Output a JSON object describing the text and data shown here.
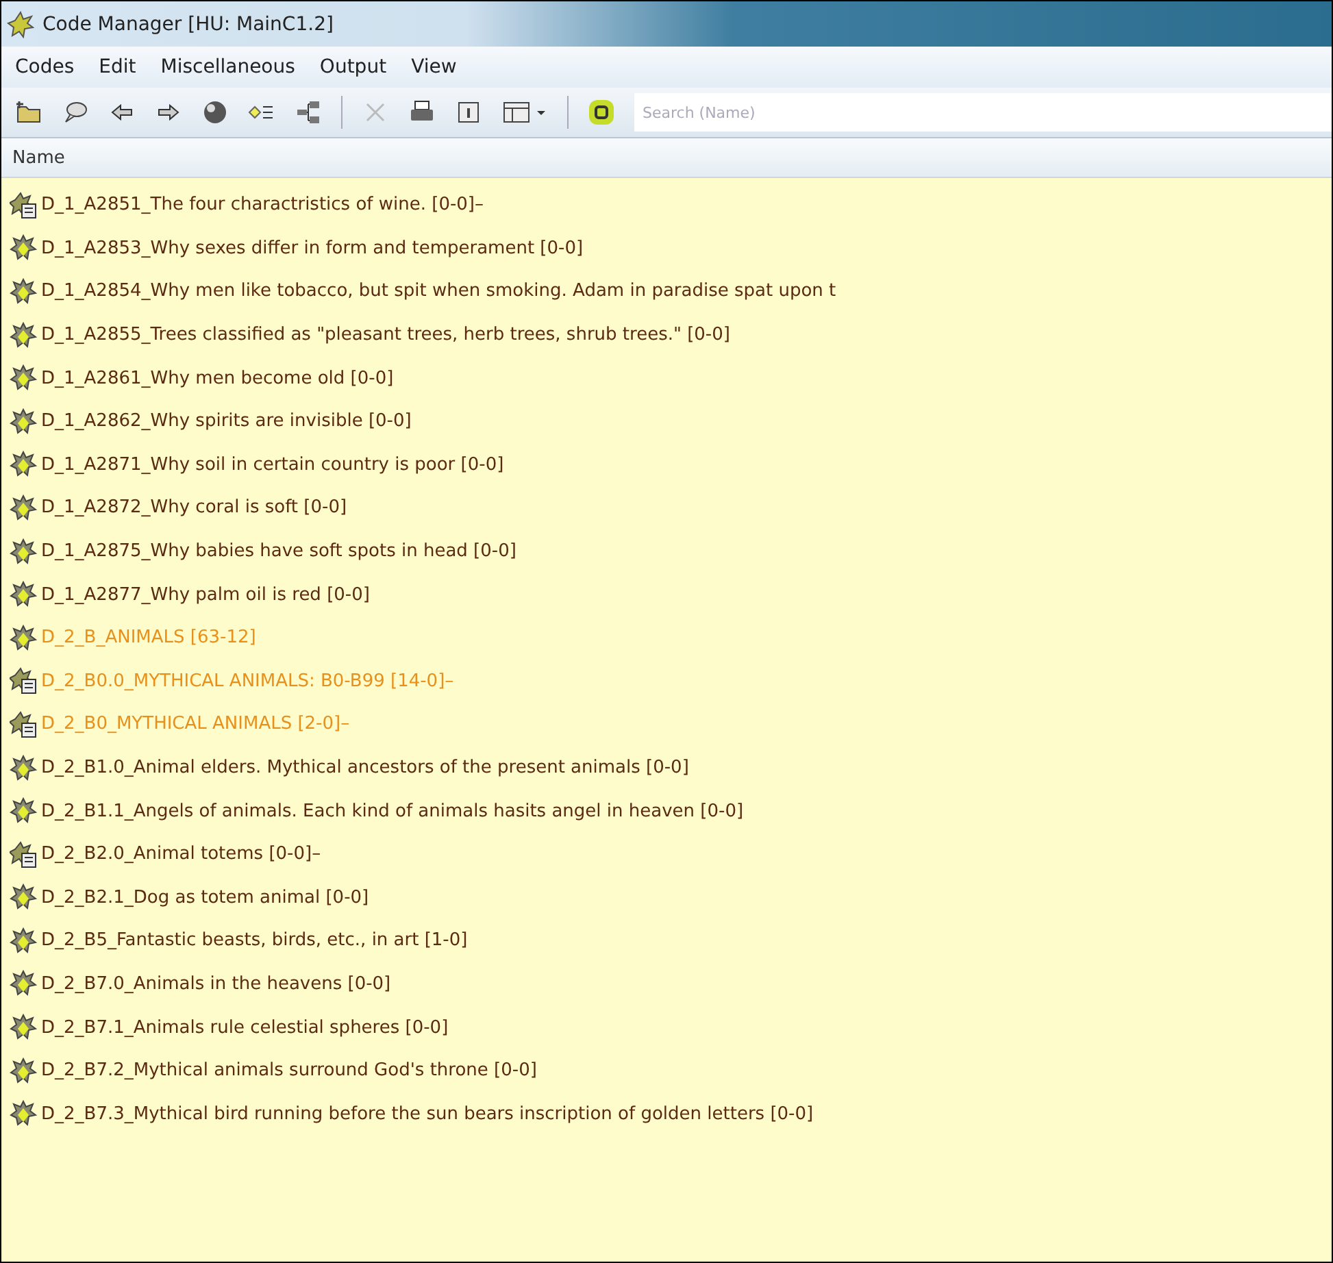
{
  "window": {
    "title": "Code Manager [HU: MainC1.2]"
  },
  "menu": [
    "Codes",
    "Edit",
    "Miscellaneous",
    "Output",
    "View"
  ],
  "search": {
    "placeholder": "Search (Name)"
  },
  "table": {
    "columns": [
      "Name"
    ],
    "rows": [
      {
        "kind": "family",
        "color": "#5a2a12",
        "name": "D_1_A2851_The four charactristics of wine. [0-0]–"
      },
      {
        "kind": "code",
        "color": "#5a2a12",
        "name": "D_1_A2853_Why sexes differ in form and temperament [0-0]"
      },
      {
        "kind": "code",
        "color": "#5a2a12",
        "name": "D_1_A2854_Why men like tobacco, but spit when smoking. Adam in paradise spat upon t"
      },
      {
        "kind": "code",
        "color": "#5a2a12",
        "name": "D_1_A2855_Trees classified as \"pleasant trees, herb trees, shrub trees.\" [0-0]"
      },
      {
        "kind": "code",
        "color": "#5a2a12",
        "name": "D_1_A2861_Why men become old [0-0]"
      },
      {
        "kind": "code",
        "color": "#5a2a12",
        "name": "D_1_A2862_Why spirits are invisible [0-0]"
      },
      {
        "kind": "code",
        "color": "#5a2a12",
        "name": "D_1_A2871_Why soil in certain country is poor [0-0]"
      },
      {
        "kind": "code",
        "color": "#5a2a12",
        "name": "D_1_A2872_Why coral is soft [0-0]"
      },
      {
        "kind": "code",
        "color": "#5a2a12",
        "name": "D_1_A2875_Why babies have soft spots in head [0-0]"
      },
      {
        "kind": "code",
        "color": "#5a2a12",
        "name": "D_1_A2877_Why palm oil is red [0-0]"
      },
      {
        "kind": "code",
        "color": "#e8901c",
        "name": "D_2_B_ANIMALS [63-12]"
      },
      {
        "kind": "family",
        "color": "#e8901c",
        "name": "D_2_B0.0_MYTHICAL ANIMALS: B0-B99 [14-0]–"
      },
      {
        "kind": "family",
        "color": "#e8901c",
        "name": "D_2_B0_MYTHICAL ANIMALS [2-0]–"
      },
      {
        "kind": "code",
        "color": "#5a2a12",
        "name": "D_2_B1.0_Animal elders. Mythical ancestors of the present animals [0-0]"
      },
      {
        "kind": "code",
        "color": "#5a2a12",
        "name": "D_2_B1.1_Angels of animals. Each kind of animals hasits angel in heaven [0-0]"
      },
      {
        "kind": "family",
        "color": "#5a2a12",
        "name": "D_2_B2.0_Animal totems [0-0]–"
      },
      {
        "kind": "code",
        "color": "#5a2a12",
        "name": "D_2_B2.1_Dog as totem animal [0-0]"
      },
      {
        "kind": "code",
        "color": "#5a2a12",
        "name": "D_2_B5_Fantastic beasts, birds, etc., in art [1-0]"
      },
      {
        "kind": "code",
        "color": "#5a2a12",
        "name": "D_2_B7.0_Animals in the heavens [0-0]"
      },
      {
        "kind": "code",
        "color": "#5a2a12",
        "name": "D_2_B7.1_Animals rule celestial spheres [0-0]"
      },
      {
        "kind": "code",
        "color": "#5a2a12",
        "name": "D_2_B7.2_Mythical animals surround God's throne [0-0]"
      },
      {
        "kind": "code",
        "color": "#5a2a12",
        "name": "D_2_B7.3_Mythical bird running before the sun bears inscription of golden letters [0-0]"
      }
    ]
  }
}
